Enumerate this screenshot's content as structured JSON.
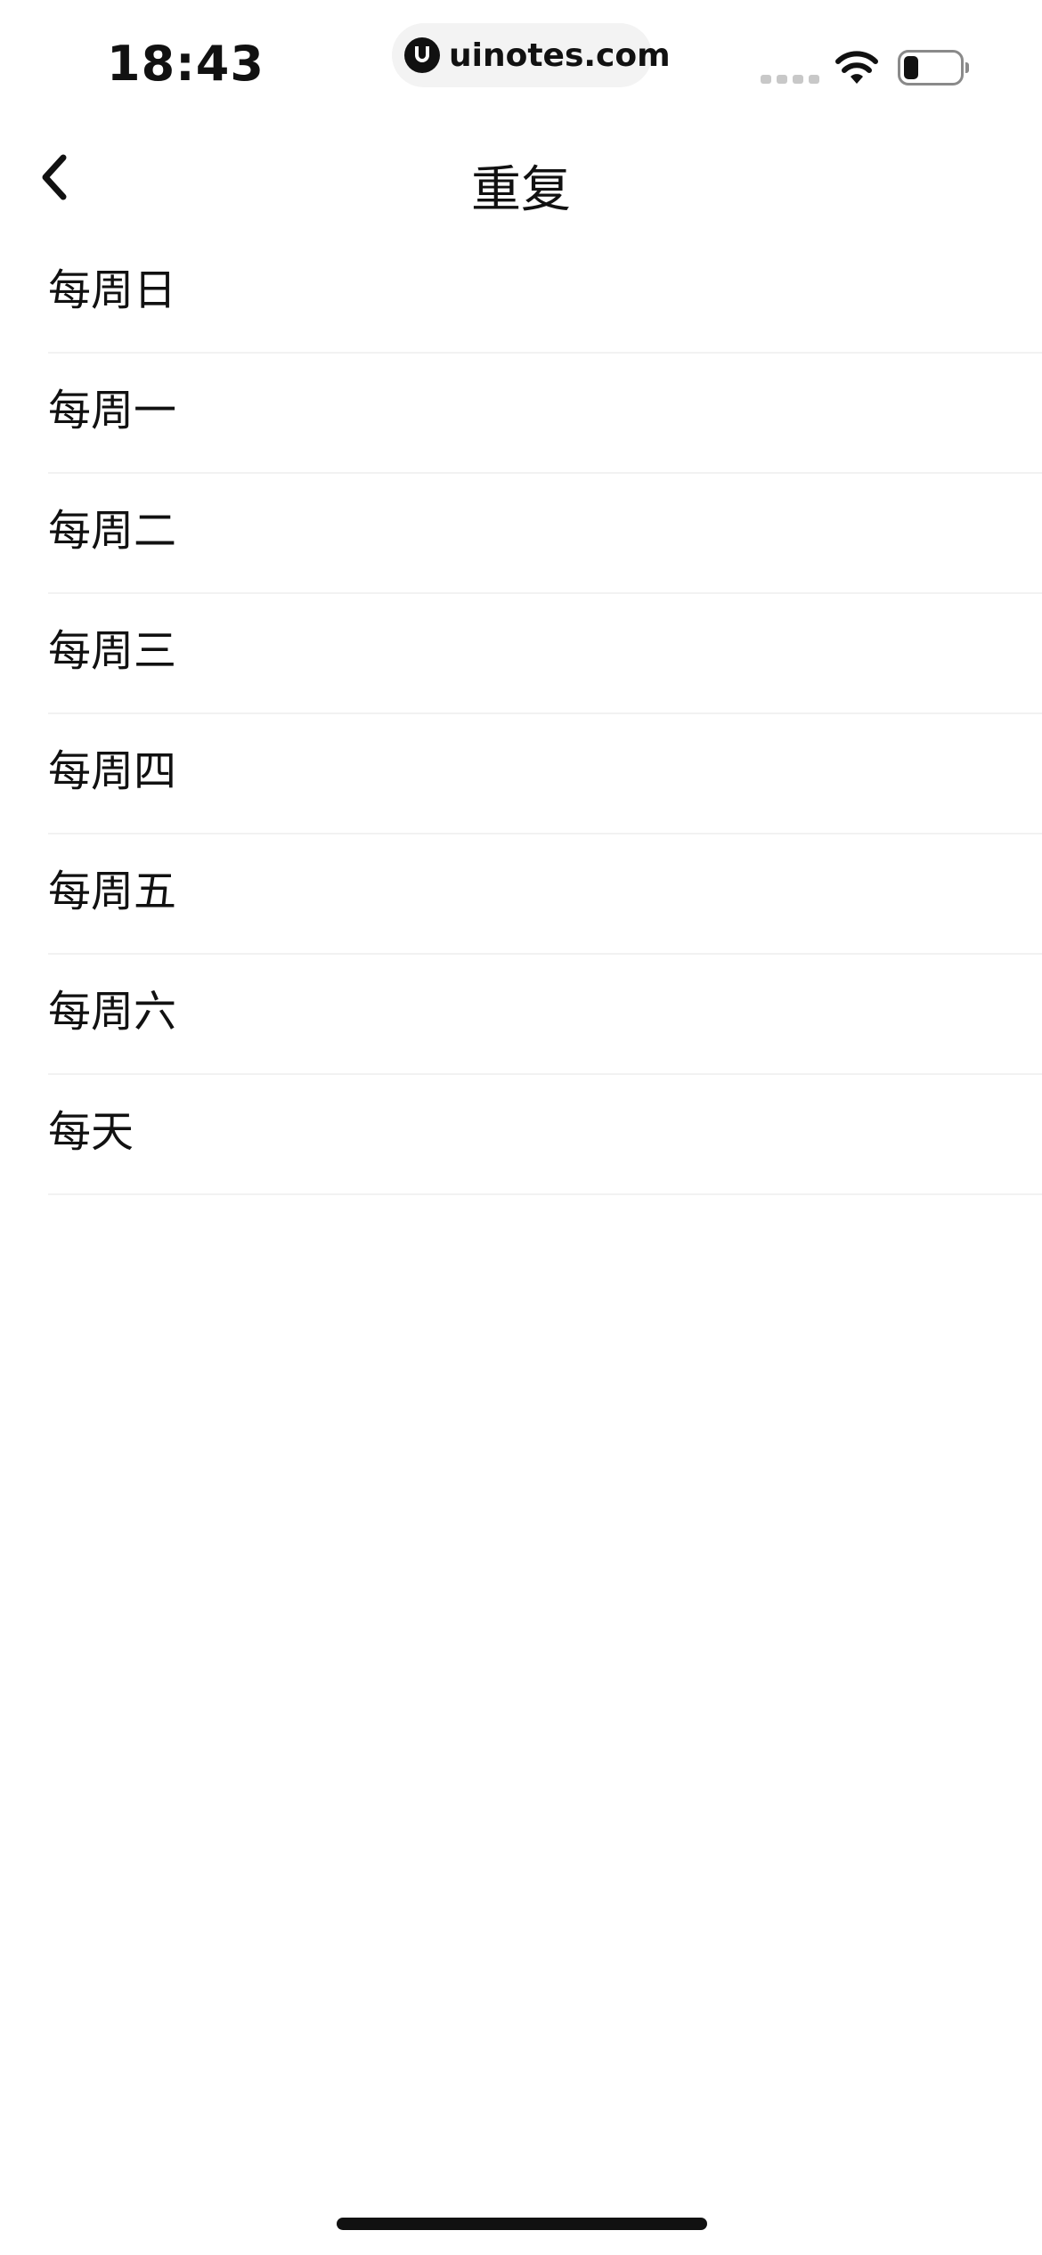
{
  "status_bar": {
    "time": "18:43",
    "url": "uinotes.com",
    "logo_icon": "uinotes-logo-icon",
    "wifi_icon": "wifi-icon",
    "battery_icon": "battery-icon",
    "battery_level": 0.25
  },
  "nav": {
    "back_icon": "chevron-left-icon",
    "title": "重复"
  },
  "repeat_options": [
    {
      "label": "每周日"
    },
    {
      "label": "每周一"
    },
    {
      "label": "每周二"
    },
    {
      "label": "每周三"
    },
    {
      "label": "每周四"
    },
    {
      "label": "每周五"
    },
    {
      "label": "每周六"
    },
    {
      "label": "每天"
    }
  ]
}
